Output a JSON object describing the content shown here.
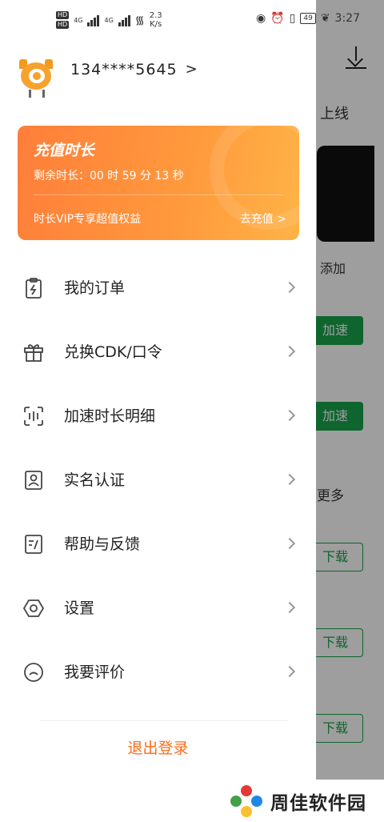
{
  "status_bar": {
    "hd1": "HD",
    "hd2": "HD",
    "net1": "4G",
    "net2": "4G",
    "speed": "2.3\nK/s",
    "battery": "49",
    "time": "3:27"
  },
  "background": {
    "text_launch": "上线",
    "text_add": "添加",
    "btn_accelerate_1": "加速",
    "btn_accelerate_2": "加速",
    "text_more": "更多",
    "btn_download_1": "下载",
    "btn_download_2": "下载",
    "btn_download_3": "下载"
  },
  "profile": {
    "phone": "134****5645",
    "chevron": ">"
  },
  "recharge_card": {
    "title": "充值时长",
    "remaining": "剩余时长：00 时 59 分 13 秒",
    "vip_text": "时长VIP专享超值权益",
    "action": "去充值 >"
  },
  "menu": {
    "items": [
      {
        "label": "我的订单",
        "icon": "clipboard-bolt-icon"
      },
      {
        "label": "兑换CDK/口令",
        "icon": "gift-icon"
      },
      {
        "label": "加速时长明细",
        "icon": "scan-detail-icon"
      },
      {
        "label": "实名认证",
        "icon": "id-card-icon"
      },
      {
        "label": "帮助与反馈",
        "icon": "feedback-icon"
      },
      {
        "label": "设置",
        "icon": "hexagon-settings-icon"
      },
      {
        "label": "我要评价",
        "icon": "smile-icon"
      }
    ]
  },
  "logout_label": "退出登录",
  "watermark": {
    "text": "周佳软件园"
  },
  "colors": {
    "accent": "#ff6a1a",
    "card_start": "#ff7e3a",
    "card_end": "#ffb347",
    "green": "#17a34a"
  }
}
